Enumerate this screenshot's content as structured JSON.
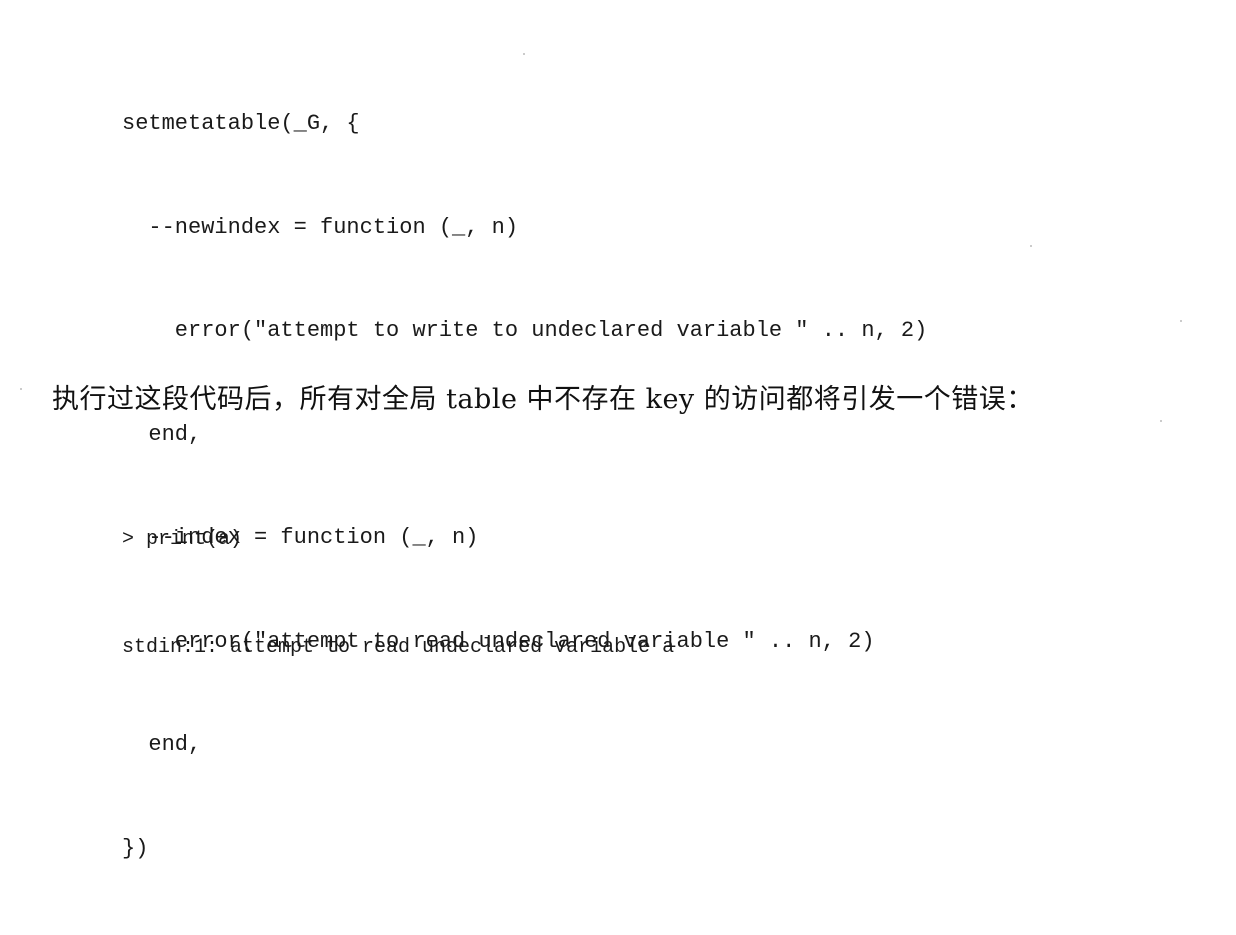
{
  "code": {
    "lines": [
      "setmetatable(_G, {",
      "  --newindex = function (_, n)",
      "    error(\"attempt to write to undeclared variable \" .. n, 2)",
      "  end,",
      "  --index = function (_, n)",
      "    error(\"attempt to read undeclared variable \" .. n, 2)",
      "  end,",
      "})"
    ]
  },
  "prose": {
    "text": "执行过这段代码后，所有对全局 table 中不存在 key 的访问都将引发一个错误："
  },
  "output": {
    "lines": [
      "> print(a)",
      "stdin:1: attempt to read undeclared variable a"
    ]
  }
}
